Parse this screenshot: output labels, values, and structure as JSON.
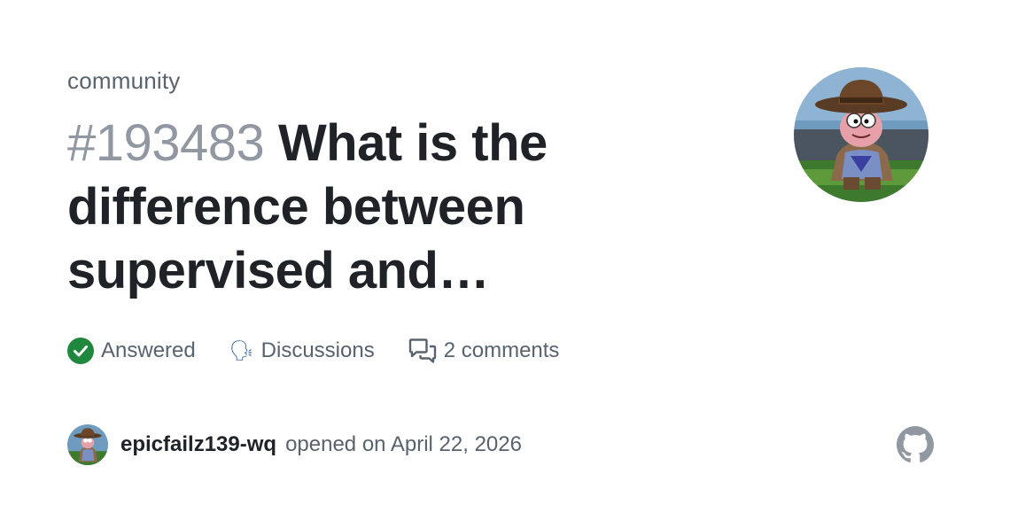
{
  "repo": "community",
  "title": {
    "number": "#193483",
    "text": "What is the difference between supervised and…"
  },
  "meta": {
    "status": "Answered",
    "category_emoji": "🗣",
    "category": "Discussions",
    "comments": "2 comments"
  },
  "author": {
    "name": "epicfailz139-wq",
    "opened": "opened on April 22, 2026"
  },
  "colors": {
    "answered_green": "#1f883d",
    "muted": "#59636e",
    "number_gray": "#9198a1",
    "text": "#1f2328"
  },
  "icons": [
    "check-circle-icon",
    "speaking-head-icon",
    "comment-discussion-icon",
    "github-mark-icon"
  ]
}
